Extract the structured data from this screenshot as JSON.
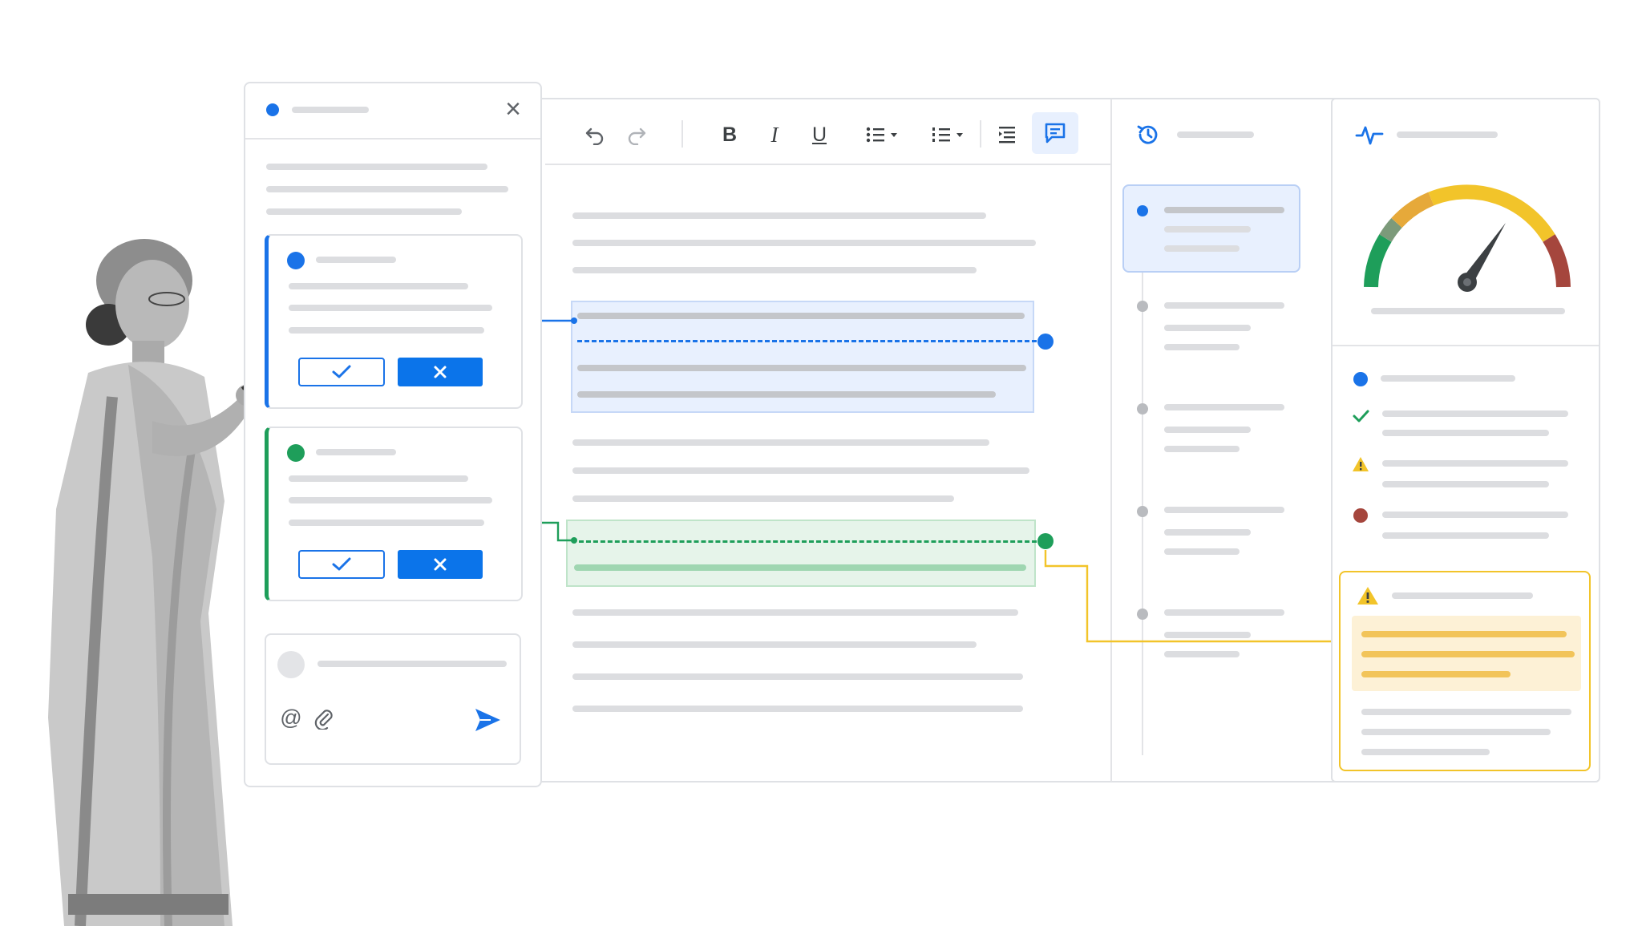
{
  "colors": {
    "blue": "#1a73e8",
    "green": "#1e9e5a",
    "yellow": "#f2c42a",
    "orange": "#e6a93a",
    "red": "#a5463d",
    "gray_line": "#dcdde0"
  },
  "toolbar": {
    "undo_icon": "undo-icon",
    "redo_icon": "redo-icon",
    "bold_label": "B",
    "italic_label": "I",
    "underline_label": "U",
    "bullet_list_icon": "bulleted-list-icon",
    "numbered_list_icon": "numbered-list-icon",
    "indent_icon": "indent-icon",
    "comment_icon": "comment-icon"
  },
  "comments_panel": {
    "close_label": "×",
    "cards": [
      {
        "accent": "blue"
      },
      {
        "accent": "green"
      }
    ],
    "composer": {
      "mention_label": "@",
      "attach_icon": "paperclip-icon",
      "send_icon": "send-icon"
    }
  },
  "history_panel": {
    "icon": "history-icon",
    "entries": 5
  },
  "health_panel": {
    "icon": "activity-pulse-icon",
    "gauge_icon": "gauge-icon",
    "status_items": [
      "info-dot-icon",
      "check-icon",
      "warning-icon",
      "error-dot-icon"
    ],
    "alert_icon": "warning-icon"
  }
}
